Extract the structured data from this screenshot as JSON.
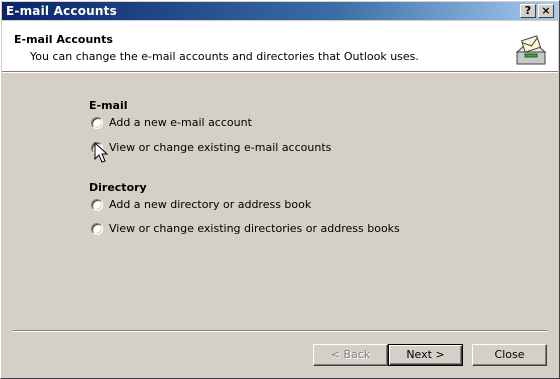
{
  "window": {
    "title": "E-mail Accounts",
    "help_label": "?",
    "close_label": "×"
  },
  "header": {
    "title": "E-mail Accounts",
    "description": "You can change the e-mail accounts and directories that Outlook uses.",
    "icon": "mail-tray-icon"
  },
  "email_section": {
    "label": "E-mail",
    "options": [
      {
        "label": "Add a new e-mail account",
        "checked": false
      },
      {
        "label": "View or change existing e-mail accounts",
        "checked": true
      }
    ]
  },
  "directory_section": {
    "label": "Directory",
    "options": [
      {
        "label": "Add a new directory or address book",
        "checked": false
      },
      {
        "label": "View or change existing directories or address books",
        "checked": false
      }
    ]
  },
  "buttons": {
    "back": "< Back",
    "next": "Next >",
    "close": "Close"
  }
}
